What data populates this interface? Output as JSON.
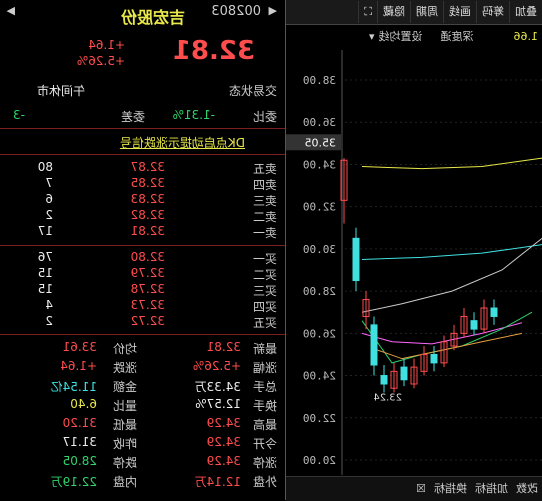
{
  "header": {
    "name": "吉宏股份",
    "code": "002803",
    "price": "32.81",
    "change": "+1.64",
    "change_pct": "+5.26%"
  },
  "toolbar": {
    "items": [
      "叠加",
      "筹码",
      "画线",
      "周期",
      "隐藏"
    ]
  },
  "subbar": {
    "text1": "设置均线",
    "text2": "深度通",
    "value": "1.66"
  },
  "axis": {
    "ticks": [
      "38.00",
      "36.00",
      "34.00",
      "32.00",
      "30.00",
      "28.00",
      "26.00",
      "24.00",
      "22.00",
      "20.00"
    ],
    "marker": "35.05",
    "low_label": "23.24"
  },
  "bottom_tabs": [
    "改数",
    "加指标",
    "换指标"
  ],
  "trade_status": {
    "label": "交易状态",
    "value": "午间休市"
  },
  "ratio": {
    "label1": "委比",
    "value1": "-1.31%",
    "label2": "委差",
    "value2": "-3"
  },
  "promo": "DK点启动提示涨跌信号",
  "sell": [
    {
      "label": "卖五",
      "price": "32.87",
      "vol": "80"
    },
    {
      "label": "卖四",
      "price": "32.85",
      "vol": "7"
    },
    {
      "label": "卖三",
      "price": "32.83",
      "vol": "6"
    },
    {
      "label": "卖二",
      "price": "32.82",
      "vol": "2"
    },
    {
      "label": "卖一",
      "price": "32.81",
      "vol": "17"
    }
  ],
  "buy": [
    {
      "label": "买一",
      "price": "32.80",
      "vol": "76"
    },
    {
      "label": "买二",
      "price": "32.79",
      "vol": "15"
    },
    {
      "label": "买三",
      "price": "32.78",
      "vol": "15"
    },
    {
      "label": "买四",
      "price": "32.73",
      "vol": "4"
    },
    {
      "label": "买五",
      "price": "32.72",
      "vol": "2"
    }
  ],
  "stats": [
    {
      "l1": "最新",
      "v1": "32.81",
      "c1": "red",
      "l2": "均价",
      "v2": "33.61",
      "c2": "red"
    },
    {
      "l1": "涨幅",
      "v1": "+5.26%",
      "c1": "red",
      "l2": "涨跌",
      "v2": "+1.64",
      "c2": "red"
    },
    {
      "l1": "总手",
      "v1": "34.33万",
      "c1": "white",
      "l2": "金额",
      "v2": "11.54亿",
      "c2": "cyan"
    },
    {
      "l1": "换手",
      "v1": "12.57%",
      "c1": "white",
      "l2": "量比",
      "v2": "6.40",
      "c2": "yellow"
    },
    {
      "l1": "最高",
      "v1": "34.29",
      "c1": "red",
      "l2": "最低",
      "v2": "31.20",
      "c2": "red"
    },
    {
      "l1": "今开",
      "v1": "34.29",
      "c1": "red",
      "l2": "昨收",
      "v2": "31.17",
      "c2": "white"
    },
    {
      "l1": "涨停",
      "v1": "34.29",
      "c1": "red",
      "l2": "跌停",
      "v2": "28.05",
      "c2": "green"
    },
    {
      "l1": "外盘",
      "v1": "12.14万",
      "c1": "red",
      "l2": "内盘",
      "v2": "22.19万",
      "c2": "green"
    }
  ],
  "colors": {
    "up": "#ff4d4d",
    "down": "#32d36a",
    "bg": "#000000"
  }
}
